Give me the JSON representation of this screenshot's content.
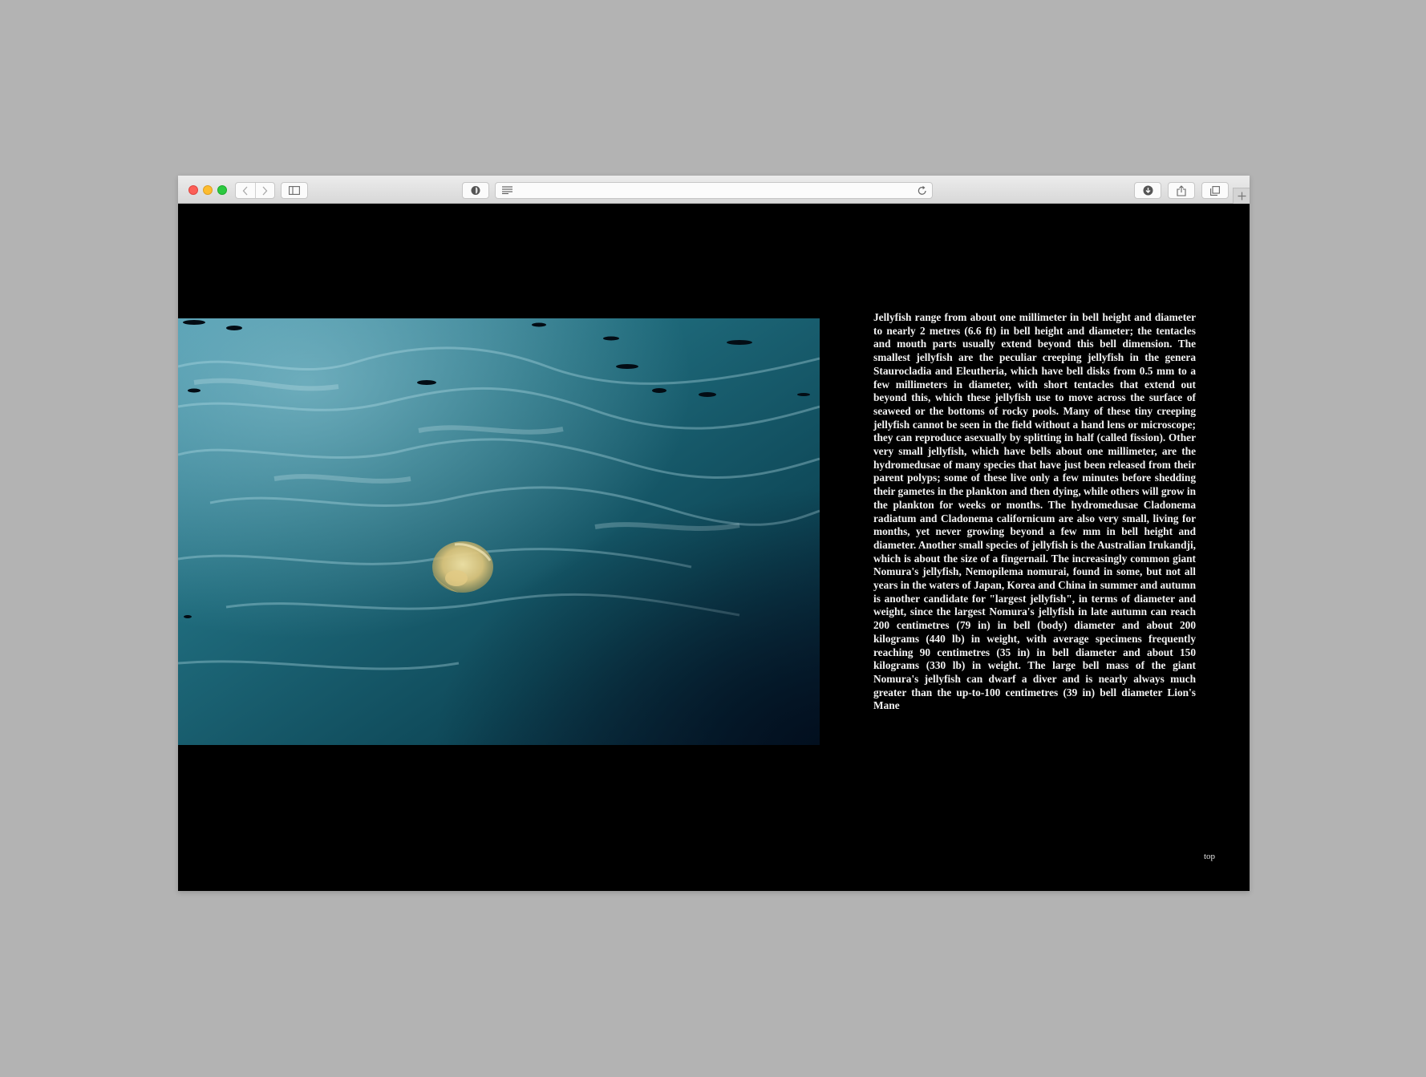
{
  "browser": {
    "url_text": "",
    "icons": {
      "back": "chevron-left-icon",
      "forward": "chevron-right-icon",
      "sidebar": "sidebar-icon",
      "privacy": "shield-icon",
      "reader": "reader-lines-icon",
      "reload": "reload-icon",
      "downloads": "download-icon",
      "share": "share-icon",
      "tabs": "tabs-overview-icon",
      "new_tab": "plus-icon"
    }
  },
  "page": {
    "image": {
      "subject": "jellyfish-in-sea-photo"
    },
    "article_text": "Jellyfish range from about one millimeter in bell height and diameter to nearly 2 metres (6.6 ft) in bell height and diameter; the tentacles and mouth parts usually extend beyond this bell dimension. The smallest jellyfish are the peculiar creeping jellyfish in the genera Staurocladia and Eleutheria, which have bell disks from 0.5 mm to a few millimeters in diameter, with short tentacles that extend out beyond this, which these jellyfish use to move across the surface of seaweed or the bottoms of rocky pools. Many of these tiny creeping jellyfish cannot be seen in the field without a hand lens or microscope; they can reproduce asexually by splitting in half (called fission). Other very small jellyfish, which have bells about one millimeter, are the hydromedusae of many species that have just been released from their parent polyps; some of these live only a few minutes before shedding their gametes in the plankton and then dying, while others will grow in the plankton for weeks or months. The hydromedusae Cladonema radiatum and Cladonema californicum are also very small, living for months, yet never growing beyond a few mm in bell height and diameter. Another small species of jellyfish is the Australian Irukandji, which is about the size of a fingernail. The increasingly common giant Nomura's jellyfish, Nemopilema nomurai, found in some, but not all years in the waters of Japan, Korea and China in summer and autumn is another candidate for \"largest jellyfish\", in terms of diameter and weight, since the largest Nomura's jellyfish in late autumn can reach 200 centimetres (79 in) in bell (body) diameter and about 200 kilograms (440 lb) in weight, with average specimens frequently reaching 90 centimetres (35 in) in bell diameter and about 150 kilograms (330 lb) in weight. The large bell mass of the giant Nomura's jellyfish can dwarf a diver and is nearly always much greater than the up-to-100 centimetres (39 in) bell diameter Lion's Mane",
    "top_link": "top"
  },
  "colors": {
    "page_background": "#000000",
    "desktop": "#b3b3b3",
    "text": "#f2f2f2"
  }
}
